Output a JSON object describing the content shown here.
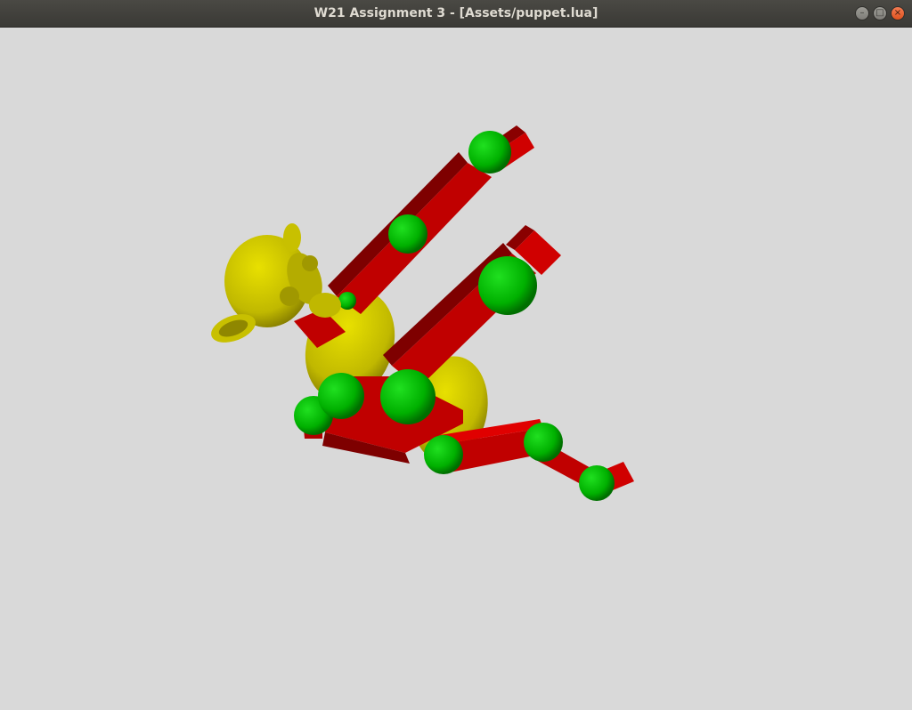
{
  "window": {
    "title": "W21 Assignment 3 - [Assets/puppet.lua]",
    "buttons": {
      "minimize_glyph": "–",
      "maximize_glyph": "□",
      "close_glyph": "×"
    }
  },
  "scene": {
    "background": "#d9d9d9",
    "colors": {
      "limb_red": "#c00000",
      "limb_red_dark": "#7e0000",
      "limb_red_light": "#e00000",
      "joint_green": "#00b000",
      "joint_green_dark": "#006f00",
      "body_yellow": "#c8c000",
      "body_yellow_dark": "#7f7700"
    }
  }
}
